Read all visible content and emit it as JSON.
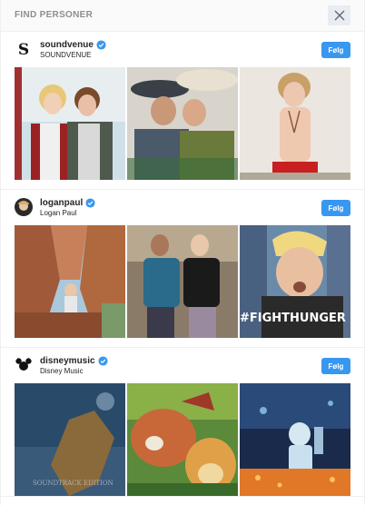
{
  "header": {
    "title": "FIND PERSONER"
  },
  "icons": {
    "close": "close-icon",
    "verified": "verified-badge-icon"
  },
  "colors": {
    "follow_bg": "#3897f0",
    "verified": "#3897f0",
    "header_text": "#8e8e8e"
  },
  "suggestions": [
    {
      "username": "soundvenue",
      "full_name": "SOUNDVENUE",
      "verified": true,
      "follow_label": "Følg",
      "avatar_letter": "S"
    },
    {
      "username": "loganpaul",
      "full_name": "Logan Paul",
      "verified": true,
      "follow_label": "Følg"
    },
    {
      "username": "disneymusic",
      "full_name": "Disney Music",
      "verified": true,
      "follow_label": "Følg"
    }
  ],
  "photo_text": {
    "fight_hunger": "#FIGHTHUNGER",
    "soundtrack": "SOUNDTRACK EDITION"
  }
}
